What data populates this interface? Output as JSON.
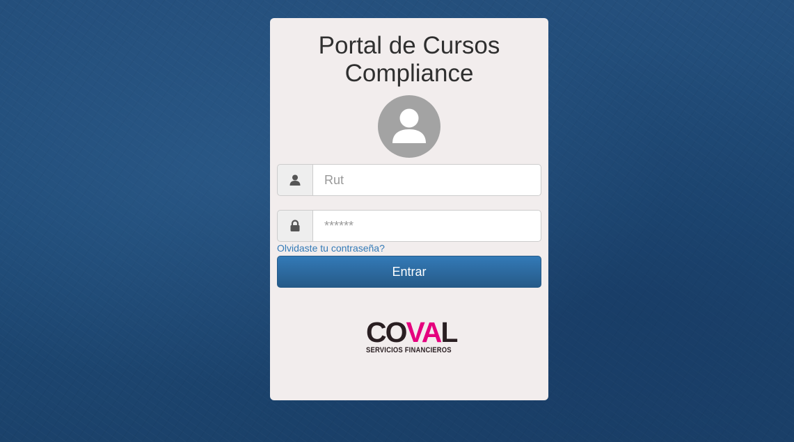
{
  "login": {
    "title_line1": "Portal de Cursos",
    "title_line2": "Compliance",
    "rut_placeholder": "Rut",
    "password_placeholder": "******",
    "forgot_label": "Olvidaste tu contraseña?",
    "submit_label": "Entrar"
  },
  "logo": {
    "word_start": "CO",
    "word_accent": "VA",
    "word_end": "L",
    "tagline": "SERVICIOS FINANCIEROS"
  },
  "icons": {
    "avatar": "user-silhouette-icon",
    "rut": "user-icon",
    "password": "lock-icon"
  },
  "colors": {
    "background": "#1e4a76",
    "card": "#f2eded",
    "button": "#337ab7",
    "link": "#337ab7",
    "brand_accent": "#e5007e"
  }
}
